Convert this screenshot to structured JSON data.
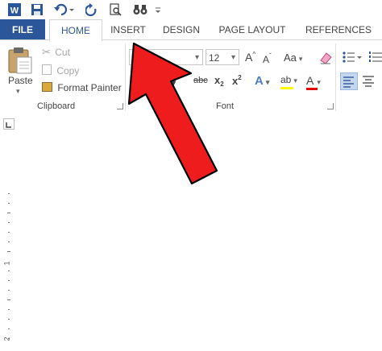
{
  "qat": {
    "icons": [
      "word-icon",
      "save-icon",
      "undo-icon",
      "redo-icon",
      "print-preview-icon",
      "binoculars-icon",
      "customize-icon"
    ]
  },
  "tabs": {
    "file": "FILE",
    "home": "HOME",
    "insert": "INSERT",
    "design": "DESIGN",
    "page_layout": "PAGE LAYOUT",
    "references": "REFERENCES"
  },
  "clipboard": {
    "paste": "Paste",
    "cut": "Cut",
    "copy": "Copy",
    "format_painter": "Format Painter",
    "label": "Clipboard"
  },
  "font": {
    "size": "12",
    "grow": "A",
    "shrink": "A",
    "case": "Aa",
    "strikethrough": "abc",
    "subscript": "x",
    "superscript": "x",
    "text_effects": "A",
    "highlight": "ab",
    "font_color": "A",
    "label": "Font",
    "colors": {
      "font_color_bar": "#e00000",
      "highlight_bar": "#ffff00"
    }
  },
  "ruler": {
    "marks": [
      "1",
      "2"
    ]
  },
  "annotation": {
    "arrow_color": "#ee1c1c",
    "arrow_outline": "#000000"
  },
  "colors": {
    "file_tab": "#2b579a",
    "accent": "#2b579a"
  }
}
